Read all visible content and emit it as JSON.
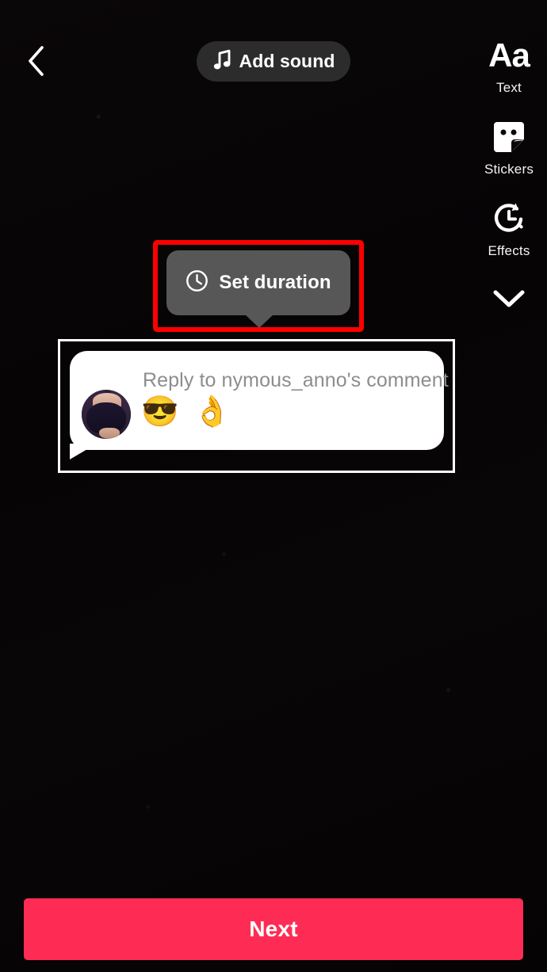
{
  "app": {
    "name": "TikTok Video Editor",
    "screen": "post-capture-editor"
  },
  "colors": {
    "background": "#070506",
    "accent_pink": "#fe2c55",
    "highlight_red": "#ff0000",
    "pill_gray": "#2c2c2c",
    "tooltip_gray": "#575757",
    "sticker_white": "#ffffff",
    "comment_text_gray": "#8d8d8d"
  },
  "topbar": {
    "back": {
      "icon": "chevron-left-icon",
      "label": "Back"
    },
    "add_sound": {
      "icon": "music-note-icon",
      "label": "Add sound"
    }
  },
  "right_rail": {
    "items": [
      {
        "icon": "text-aa-icon",
        "glyph": "Aa",
        "label": "Text"
      },
      {
        "icon": "sticker-icon",
        "label": "Stickers"
      },
      {
        "icon": "effects-clock-icon",
        "label": "Effects"
      }
    ],
    "collapse": {
      "icon": "chevron-down-icon",
      "label": "Collapse tools"
    }
  },
  "tooltip": {
    "icon": "clock-icon",
    "label": "Set duration",
    "highlighted": true
  },
  "comment_sticker": {
    "selected": true,
    "avatar": "user-avatar",
    "text": "Reply to nymous_anno's comment",
    "emojis": "😎 👌"
  },
  "bottom_bar": {
    "next": {
      "label": "Next"
    }
  }
}
